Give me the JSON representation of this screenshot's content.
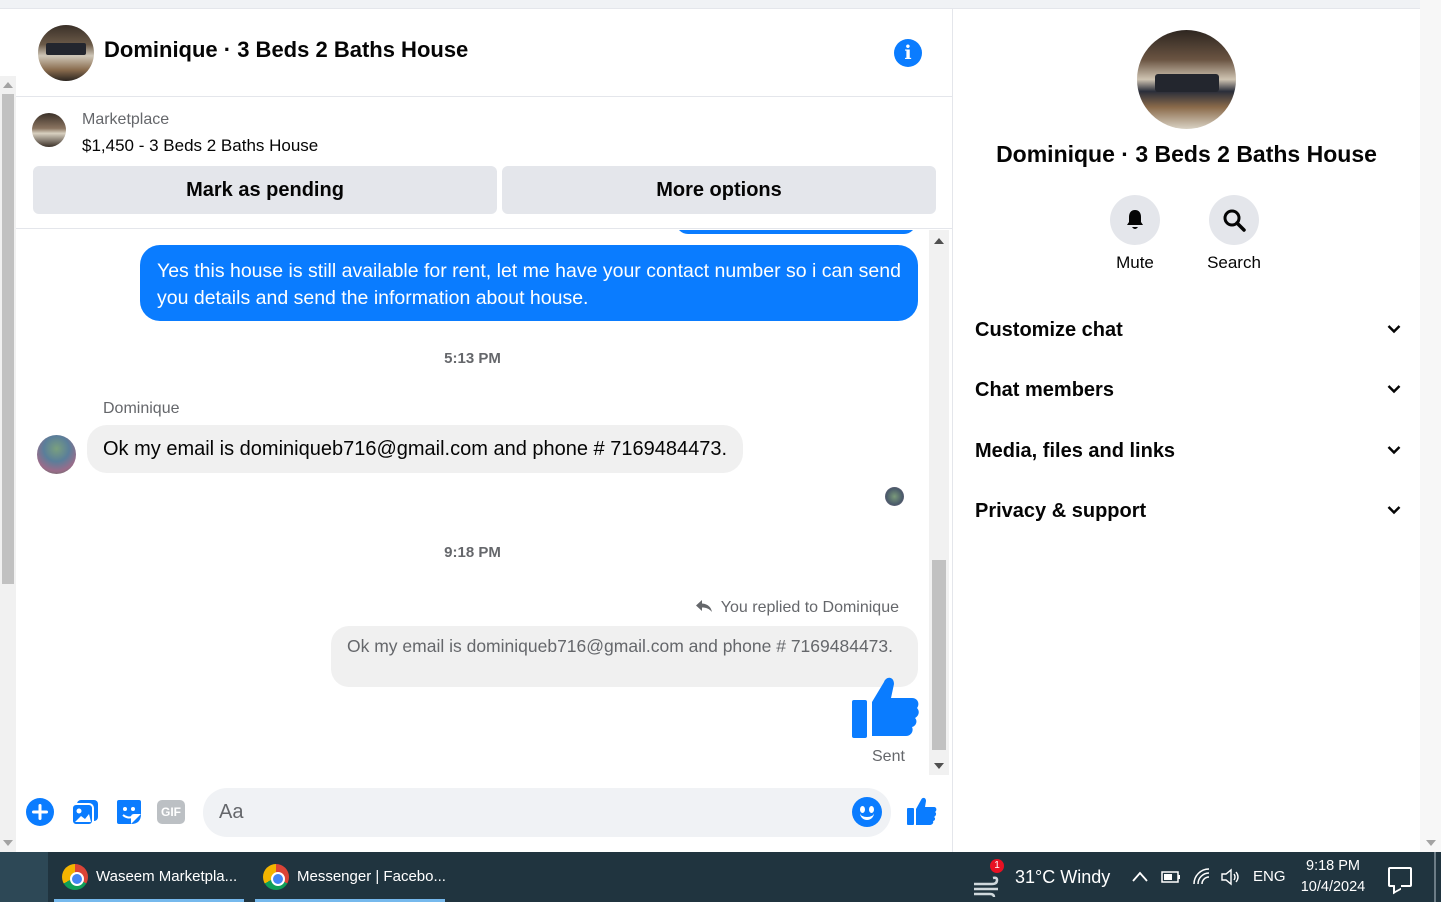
{
  "chat": {
    "title": "Dominique · 3 Beds 2 Baths House",
    "marketplace": {
      "label": "Marketplace",
      "listing": "$1,450 - 3 Beds 2 Baths House",
      "mark_pending": "Mark as pending",
      "more_options": "More options"
    },
    "messages": {
      "outgoing_1": "Yes this house is still available for rent, let me have your contact number so i can send you details and send the information about house.",
      "timestamp_1": "5:13 PM",
      "sender_name": "Dominique",
      "incoming_1": "Ok my email is dominiqueb716@gmail.com and phone # 7169484473.",
      "timestamp_2": "9:18 PM",
      "replied_label": "You replied to Dominique",
      "reply_quote": "Ok my email is dominiqueb716@gmail.com and phone # 7169484473.",
      "status": "Sent"
    },
    "composer": {
      "placeholder": "Aa",
      "gif_label": "GIF"
    }
  },
  "panel": {
    "name": "Dominique · 3 Beds 2 Baths House",
    "actions": {
      "mute": "Mute",
      "search": "Search"
    },
    "sections": [
      "Customize chat",
      "Chat members",
      "Media, files and links",
      "Privacy & support"
    ]
  },
  "taskbar": {
    "apps": [
      "Waseem Marketpla...",
      "Messenger | Facebo..."
    ],
    "weather": "31°C  Windy",
    "weather_badge": "1",
    "language": "ENG",
    "time": "9:18 PM",
    "date": "10/4/2024"
  },
  "colors": {
    "accent": "#0a7cff",
    "bubble_in": "#f0f0f0",
    "taskbar": "#20343f"
  }
}
